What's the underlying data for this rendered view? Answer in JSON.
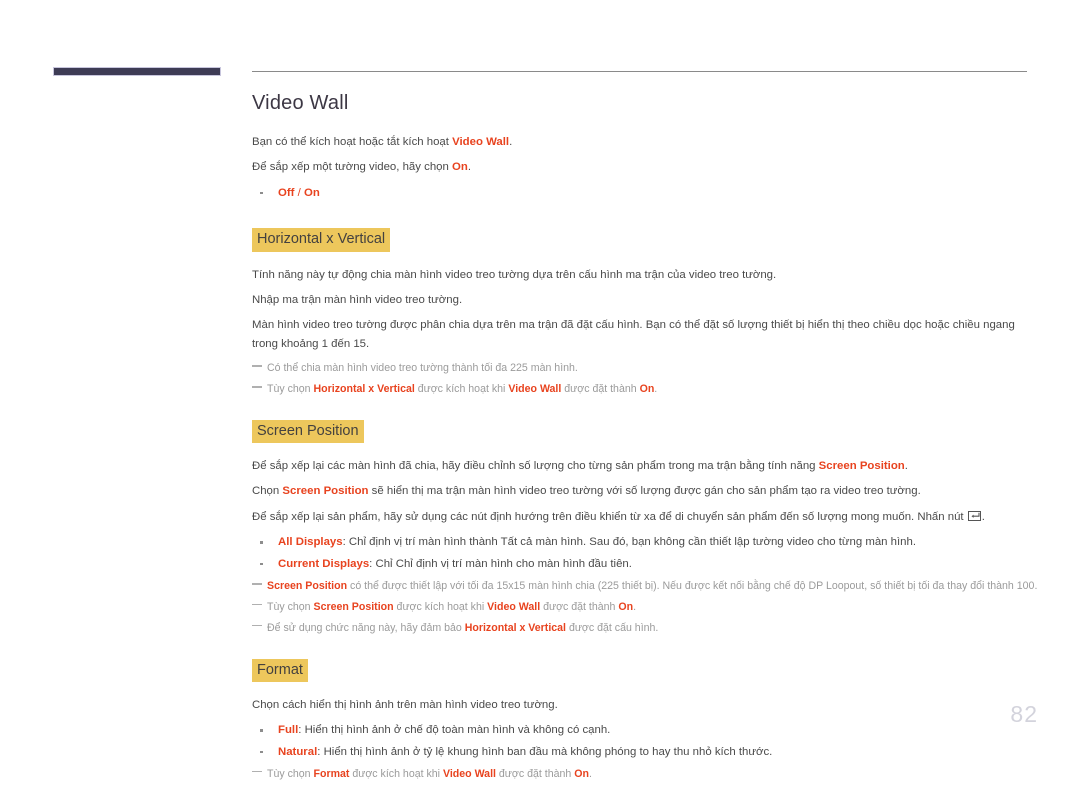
{
  "document": {
    "page_number": "82",
    "title": "Video Wall"
  },
  "colors": {
    "keyword": "#e8431f",
    "heading_highlight": "#edc75c",
    "rail_bar": "#3e3c55",
    "page_number": "#d3d3dc"
  },
  "intro": {
    "line1_a": "Bạn có thể kích hoạt hoặc tắt kích hoạt ",
    "line1_kw": "Video Wall",
    "line1_b": ".",
    "line2_a": "Để sắp xếp một tường video, hãy chọn ",
    "line2_kw": "On",
    "line2_b": ".",
    "bullet_off": "Off",
    "bullet_sep": " / ",
    "bullet_on": "On"
  },
  "sections": [
    {
      "heading": "Horizontal x Vertical",
      "paragraphs": [
        "Tính năng này tự động chia màn hình video treo tường dựa trên cấu hình ma trận của video treo tường.",
        "Nhập ma trận màn hình video treo tường.",
        "Màn hình video treo tường được phân chia dựa trên ma trận đã đặt cấu hình. Bạn có thể đặt số lượng thiết bị hiển thị theo chiều dọc hoặc chiều ngang trong khoảng 1 đến 15."
      ],
      "notes": [
        {
          "text": "Có thể chia màn hình video treo tường thành tối đa 225 màn hình."
        },
        {
          "a": "Tùy chọn ",
          "kw1": "Horizontal x Vertical",
          "b": " được kích hoạt khi ",
          "kw2": "Video Wall",
          "c": " được đặt thành ",
          "kw3": "On",
          "d": "."
        }
      ]
    },
    {
      "heading": "Screen Position",
      "paragraphs": [
        {
          "a": "Để sắp xếp lại các màn hình đã chia, hãy điều chỉnh số lượng cho từng sản phẩm trong ma trận bằng tính năng ",
          "kw": "Screen Position",
          "b": "."
        },
        {
          "a": "Chọn ",
          "kw": "Screen Position",
          "b": " sẽ hiển thị ma trận màn hình video treo tường với số lượng được gán cho sản phẩm tạo ra video treo tường."
        },
        {
          "a": "Để sắp xếp lại sản phẩm, hãy sử dụng các nút định hướng trên điều khiển từ xa để di chuyển sản phẩm đến số lượng mong muốn. Nhấn nút ",
          "icon": "enter-key-icon",
          "b": "."
        }
      ],
      "bullets": [
        {
          "kw": "All Displays",
          "text": ": Chỉ định vị trí màn hình thành Tất cả màn hình. Sau đó, bạn không cần thiết lập tường video cho từng màn hình."
        },
        {
          "kw": "Current Displays",
          "text": ": Chỉ Chỉ định vị trí màn hình cho màn hình đầu tiên."
        }
      ],
      "notes": [
        {
          "kw1": "Screen Position",
          "b": " có thể được thiết lập với tối đa 15x15 màn hình chia (225 thiết bị). Nếu được kết nối bằng chế độ DP Loopout, số thiết bị tối đa thay đổi thành 100."
        },
        {
          "a": "Tùy chọn ",
          "kw1": "Screen Position",
          "b": " được kích hoạt khi ",
          "kw2": "Video Wall",
          "c": " được đặt thành ",
          "kw3": "On",
          "d": "."
        },
        {
          "a": "Để sử dụng chức năng này, hãy đảm bảo ",
          "kw1": "Horizontal x Vertical",
          "b": " được đặt cấu hình."
        }
      ]
    },
    {
      "heading": "Format",
      "paragraphs": [
        "Chọn cách hiển thị hình ảnh trên màn hình video treo tường."
      ],
      "bullets": [
        {
          "kw": "Full",
          "text": ": Hiển thị hình ảnh ở chế độ toàn màn hình và không có cạnh."
        },
        {
          "kw": "Natural",
          "text": ": Hiển thị hình ảnh ở tỷ lệ khung hình ban đầu mà không phóng to hay thu nhỏ kích thước."
        }
      ],
      "notes": [
        {
          "a": "Tùy chọn ",
          "kw1": "Format",
          "b": " được kích hoạt khi ",
          "kw2": "Video Wall",
          "c": " được đặt thành ",
          "kw3": "On",
          "d": "."
        }
      ]
    }
  ]
}
